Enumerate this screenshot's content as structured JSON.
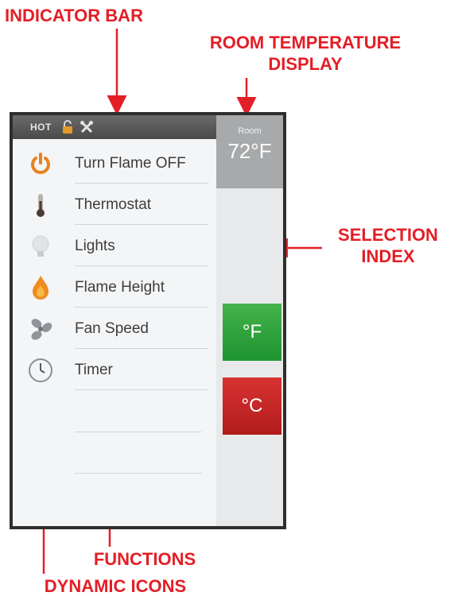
{
  "callouts": {
    "indicator_bar": "INDICATOR BAR",
    "room_temperature_line1": "ROOM TEMPERATURE",
    "room_temperature_line2": "DISPLAY",
    "selection_line1": "SELECTION",
    "selection_line2": "INDEX",
    "functions": "FUNCTIONS",
    "dynamic_icons": "DYNAMIC ICONS"
  },
  "indicator": {
    "status_text": "HOT",
    "icons": [
      "lock-icon",
      "tools-icon"
    ]
  },
  "menu": {
    "items": [
      {
        "icon": "power-icon",
        "label": "Turn Flame OFF"
      },
      {
        "icon": "thermometer-icon",
        "label": "Thermostat"
      },
      {
        "icon": "light-bulb-icon",
        "label": "Lights"
      },
      {
        "icon": "flame-icon",
        "label": "Flame Height"
      },
      {
        "icon": "fan-icon",
        "label": "Fan Speed"
      },
      {
        "icon": "clock-icon",
        "label": "Timer"
      }
    ]
  },
  "room": {
    "label": "Room",
    "temperature": "72°F"
  },
  "units": {
    "fahrenheit": "°F",
    "celsius": "°C"
  },
  "colors": {
    "callout": "#e41e26",
    "fahrenheit_button": "#2fa33d",
    "celsius_button": "#c62525",
    "room_box": "#a7a9ab",
    "power_icon": "#e8821e",
    "flame_icon": "#f08a1e"
  }
}
